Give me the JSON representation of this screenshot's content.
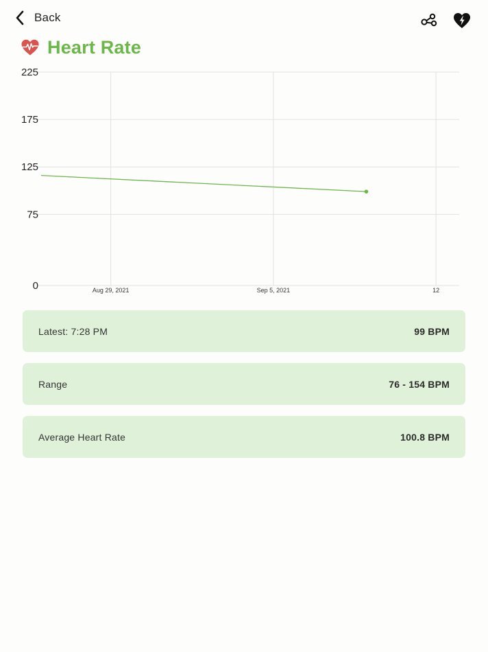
{
  "header": {
    "back_label": "Back",
    "back_icon": "chevron-left-icon",
    "share_icon": "share-icon",
    "heart_icon": "heart-bolt-icon"
  },
  "title": {
    "text": "Heart Rate",
    "icon": "heart-pulse-icon",
    "color": "#6cb64a",
    "icon_color": "#d9534f"
  },
  "chart_data": {
    "type": "line",
    "y_ticks": [
      0,
      75,
      125,
      175,
      225
    ],
    "x_ticks": [
      {
        "label": "Aug 29, 2021",
        "date": "2021-08-29"
      },
      {
        "label": "Sep 5, 2021",
        "date": "2021-09-05"
      },
      {
        "label": "12",
        "date": "2021-09-12"
      }
    ],
    "xlim": [
      "2021-08-26",
      "2021-09-13"
    ],
    "ylim": [
      0,
      225
    ],
    "series": [
      {
        "color": "#6cb64a",
        "points": [
          {
            "x": "2021-08-26",
            "y": 116
          },
          {
            "x": "2021-09-09",
            "y": 99
          }
        ]
      }
    ],
    "grid": true,
    "title": "",
    "xlabel": "",
    "ylabel": ""
  },
  "cards": [
    {
      "label": "Latest: 7:28 PM",
      "value": "99 BPM"
    },
    {
      "label": "Range",
      "value": "76 - 154 BPM"
    },
    {
      "label": "Average Heart Rate",
      "value": "100.8 BPM"
    }
  ]
}
